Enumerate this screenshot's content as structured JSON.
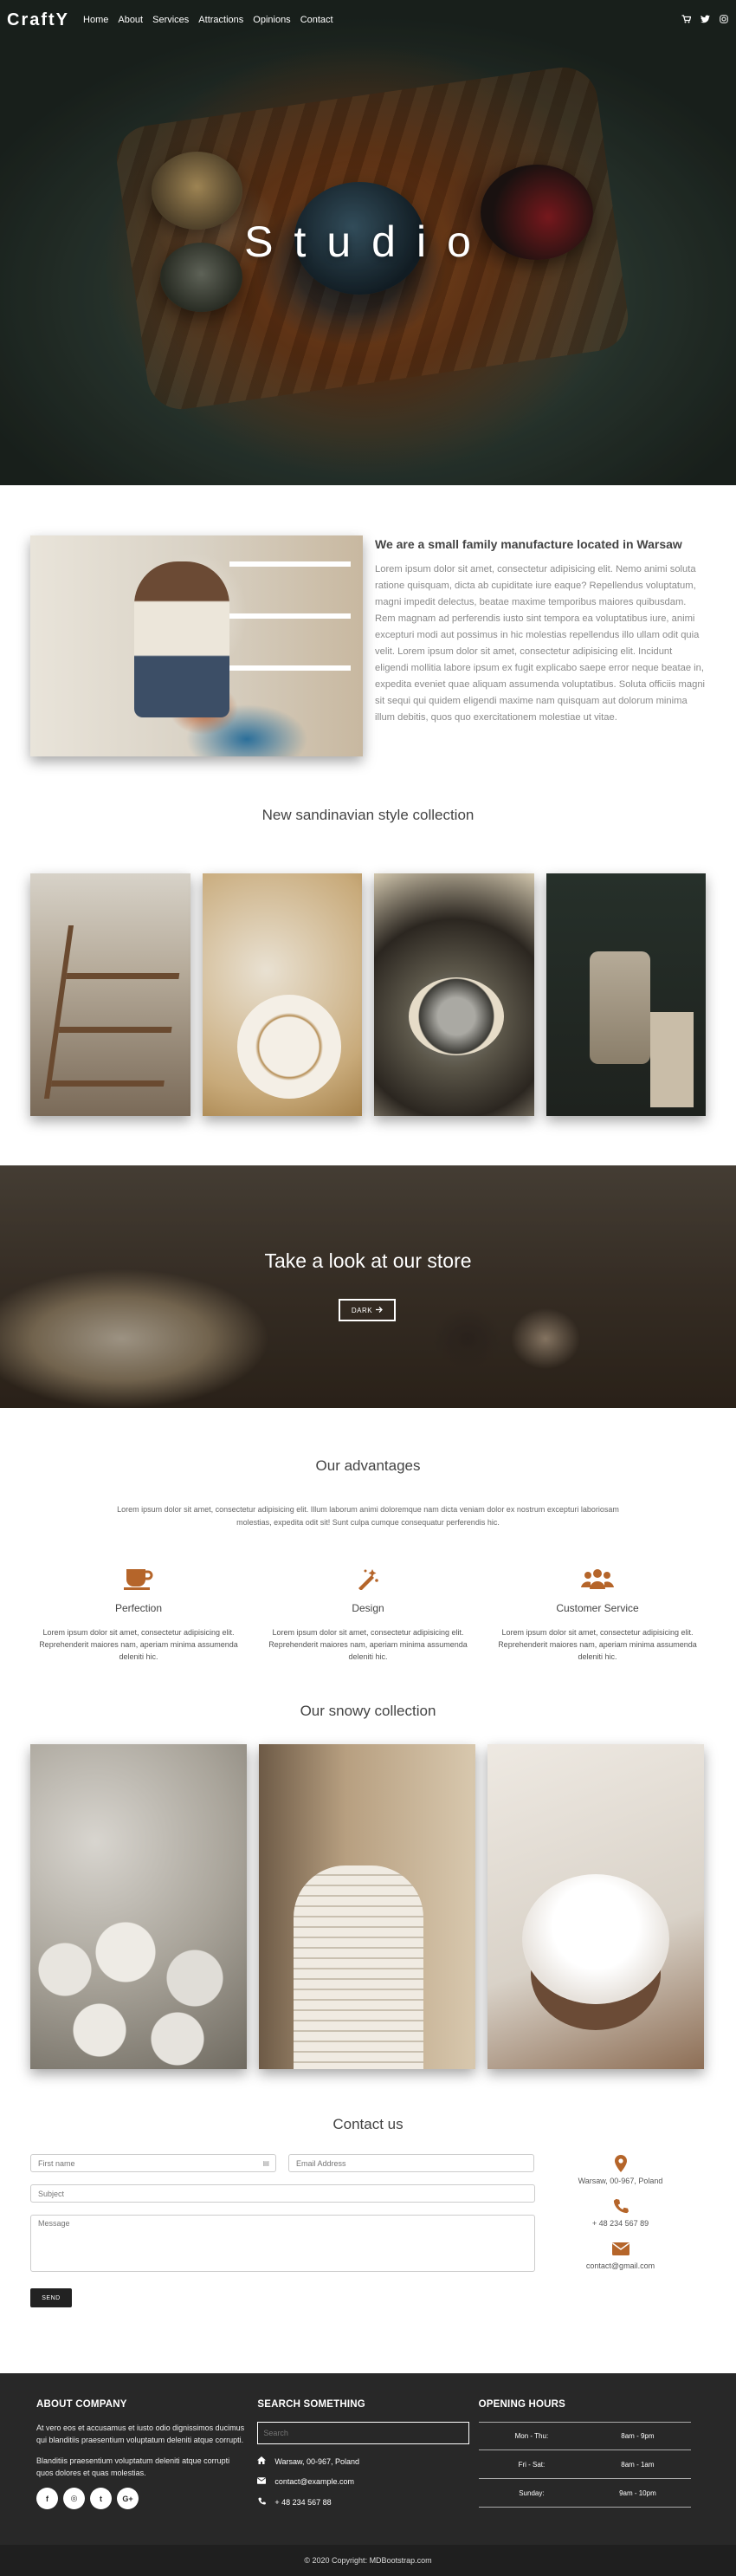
{
  "nav": {
    "brand": "CraftY",
    "links": [
      "Home",
      "About",
      "Services",
      "Attractions",
      "Opinions",
      "Contact"
    ],
    "icons": [
      "cart-icon",
      "twitter-icon",
      "instagram-icon"
    ]
  },
  "hero": {
    "title": "Studio"
  },
  "about": {
    "heading": "We are a small family manufacture located in Warsaw",
    "text": "Lorem ipsum dolor sit amet, consectetur adipisicing elit. Nemo animi soluta ratione quisquam, dicta ab cupiditate iure eaque? Repellendus voluptatum, magni impedit delectus, beatae maxime temporibus maiores quibusdam. Rem magnam ad perferendis iusto sint tempora ea voluptatibus iure, animi excepturi modi aut possimus in hic molestias repellendus illo ullam odit quia velit. Lorem ipsum dolor sit amet, consectetur adipisicing elit. Incidunt eligendi mollitia labore ipsum ex fugit explicabo saepe error neque beatae in, expedita eveniet quae aliquam assumenda voluptatibus. Soluta officiis magni sit sequi qui quidem eligendi maxime nam quisquam aut dolorum minima illum debitis, quos quo exercitationem molestiae ut vitae."
  },
  "collection": {
    "title": "New sandinavian style collection"
  },
  "store": {
    "title": "Take a look at our store",
    "button_label": "DARK"
  },
  "advantages": {
    "title": "Our advantages",
    "intro": "Lorem ipsum dolor sit amet, consectetur adipisicing elit. Illum laborum animi doloremque nam dicta veniam dolor ex nostrum excepturi laboriosam molestias, expedita odit sit! Sunt culpa cumque consequatur perferendis hic.",
    "items": [
      {
        "title": "Perfection",
        "icon": "coffee-icon",
        "text": "Lorem ipsum dolor sit amet, consectetur adipisicing elit. Reprehenderit maiores nam, aperiam minima assumenda deleniti hic."
      },
      {
        "title": "Design",
        "icon": "magic-icon",
        "text": "Lorem ipsum dolor sit amet, consectetur adipisicing elit. Reprehenderit maiores nam, aperiam minima assumenda deleniti hic."
      },
      {
        "title": "Customer Service",
        "icon": "users-icon",
        "text": "Lorem ipsum dolor sit amet, consectetur adipisicing elit. Reprehenderit maiores nam, aperiam minima assumenda deleniti hic."
      }
    ]
  },
  "snowy": {
    "title": "Our snowy collection"
  },
  "contact": {
    "title": "Contact us",
    "placeholders": {
      "first_name": "First name",
      "email": "Email Address",
      "subject": "Subject",
      "message": "Message"
    },
    "send_label": "SEND",
    "address": "Warsaw, 00-967, Poland",
    "phone": "+ 48 234 567 89",
    "email": "contact@gmail.com"
  },
  "footer": {
    "company": {
      "heading": "ABOUT COMPANY",
      "p1": "At vero eos et accusamus et iusto odio dignissimos ducimus qui blanditiis praesentium voluptatum deleniti atque corrupti.",
      "p2": "Blanditiis praesentium voluptatum deleniti atque corrupti quos dolores et quas molestias.",
      "socials": [
        "f",
        "◎",
        "t",
        "G+"
      ]
    },
    "search": {
      "heading": "SEARCH SOMETHING",
      "placeholder": "Search",
      "address": "Warsaw, 00-967, Poland",
      "email": "contact@example.com",
      "phone": "+ 48 234 567 88"
    },
    "hours": {
      "heading": "OPENING HOURS",
      "rows": [
        {
          "day": "Mon - Thu:",
          "time": "8am - 9pm"
        },
        {
          "day": "Fri - Sat:",
          "time": "8am - 1am"
        },
        {
          "day": "Sunday:",
          "time": "9am - 10pm"
        }
      ]
    },
    "copyright": "© 2020 Copyright: MDBootstrap.com"
  },
  "colors": {
    "accent": "#b5652a",
    "footer_bg": "#282828"
  }
}
